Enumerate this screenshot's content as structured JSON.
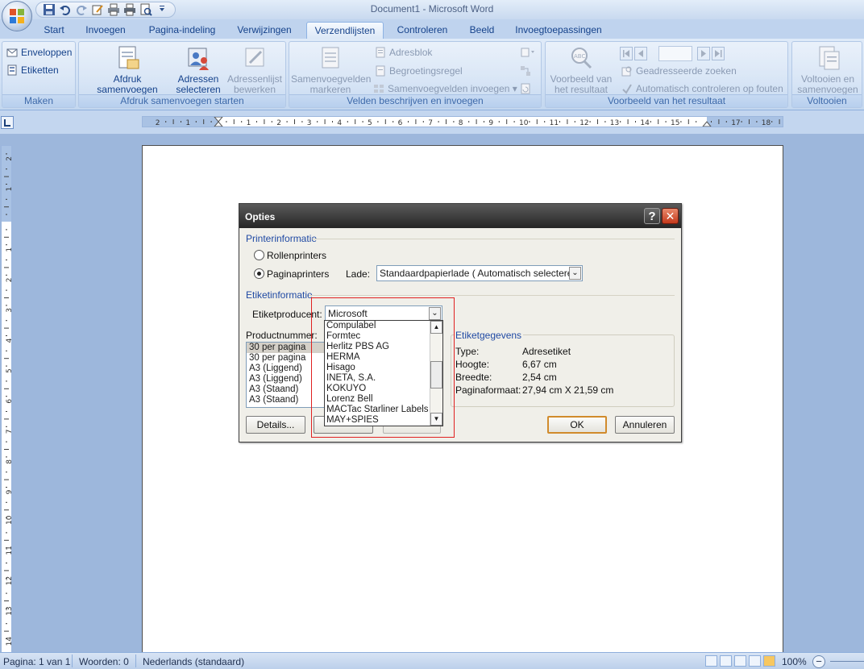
{
  "window": {
    "title": "Document1 - Microsoft Word"
  },
  "tabs": [
    "Start",
    "Invoegen",
    "Pagina-indeling",
    "Verwijzingen",
    "Verzendlijsten",
    "Controleren",
    "Beeld",
    "Invoegtoepassingen"
  ],
  "active_tab": "Verzendlijsten",
  "ribbon": {
    "maken": {
      "label": "Maken",
      "enveloppen": "Enveloppen",
      "etiketten": "Etiketten"
    },
    "afdruk": {
      "label": "Afdruk samenvoegen starten",
      "start_line1": "Afdruk samenvoegen",
      "start_line2": "starten",
      "adressen_line1": "Adressen",
      "adressen_line2": "selecteren",
      "bewerken_line1": "Adressenlijst",
      "bewerken_line2": "bewerken"
    },
    "velden": {
      "label": "Velden beschrijven en invoegen",
      "markeren_line1": "Samenvoegvelden",
      "markeren_line2": "markeren",
      "adresblok": "Adresblok",
      "begroeting": "Begroetingsregel",
      "invoegen": "Samenvoegvelden invoegen"
    },
    "voorbeeld": {
      "label": "Voorbeeld van het resultaat",
      "preview_line1": "Voorbeeld van",
      "preview_line2": "het resultaat",
      "zoeken": "Geadresseerde zoeken",
      "controleren": "Automatisch controleren op fouten"
    },
    "voltooien": {
      "label": "Voltooien",
      "line1": "Voltooien en",
      "line2": "samenvoegen"
    }
  },
  "ruler": {
    "h_labels": [
      "2",
      "1",
      "1",
      "2",
      "3",
      "4",
      "5",
      "6",
      "7",
      "8",
      "9",
      "10",
      "11",
      "12",
      "13",
      "14",
      "15",
      "17",
      "18"
    ],
    "v_labels": [
      "2",
      "1",
      "1",
      "2",
      "3",
      "4",
      "5",
      "6",
      "7",
      "8",
      "9",
      "10",
      "11",
      "12",
      "13",
      "14"
    ]
  },
  "dialog": {
    "title": "Opties",
    "help": "?",
    "close": "✕",
    "printer_section": "Printerinformatie",
    "rollenprinters": "Rollenprinters",
    "paginaprinters": "Paginaprinters",
    "lade_label": "Lade:",
    "lade_value": "Standaardpapierlade ( Automatisch selecteren)",
    "etiket_section": "Etiketinformatie",
    "producent_label": "Etiketproducent:",
    "producent_value": "Microsoft",
    "productnummer_label": "Productnummer:",
    "productnummer_items": [
      "30 per pagina",
      "30 per pagina",
      "A3 (Liggend)",
      "A3 (Liggend)",
      "A3 (Staand)",
      "A3 (Staand)"
    ],
    "gegevens_section": "Etiketgegevens",
    "gegevens": [
      {
        "k": "Type:",
        "v": "Adresetiket"
      },
      {
        "k": "Hoogte:",
        "v": "6,67 cm"
      },
      {
        "k": "Breedte:",
        "v": "2,54 cm"
      },
      {
        "k": "Paginaformaat:",
        "v": "27,94 cm X 21,59 cm"
      }
    ],
    "details_btn": "Details...",
    "ok_btn": "OK",
    "annuleren_btn": "Annuleren",
    "dropdown_items": [
      "Compulabel",
      "Formtec",
      "Herlitz PBS AG",
      "HERMA",
      "Hisago",
      "INETA, S.A.",
      "KOKUYO",
      "Lorenz Bell",
      "MACTac Starliner Labels",
      "MAY+SPIES"
    ]
  },
  "statusbar": {
    "pagina": "Pagina: 1 van 1",
    "woorden": "Woorden: 0",
    "taal": "Nederlands (standaard)",
    "zoom": "100%"
  },
  "colors": {
    "accent": "#15428b",
    "highlight": "#e02020",
    "dialog_title": "#262626"
  }
}
